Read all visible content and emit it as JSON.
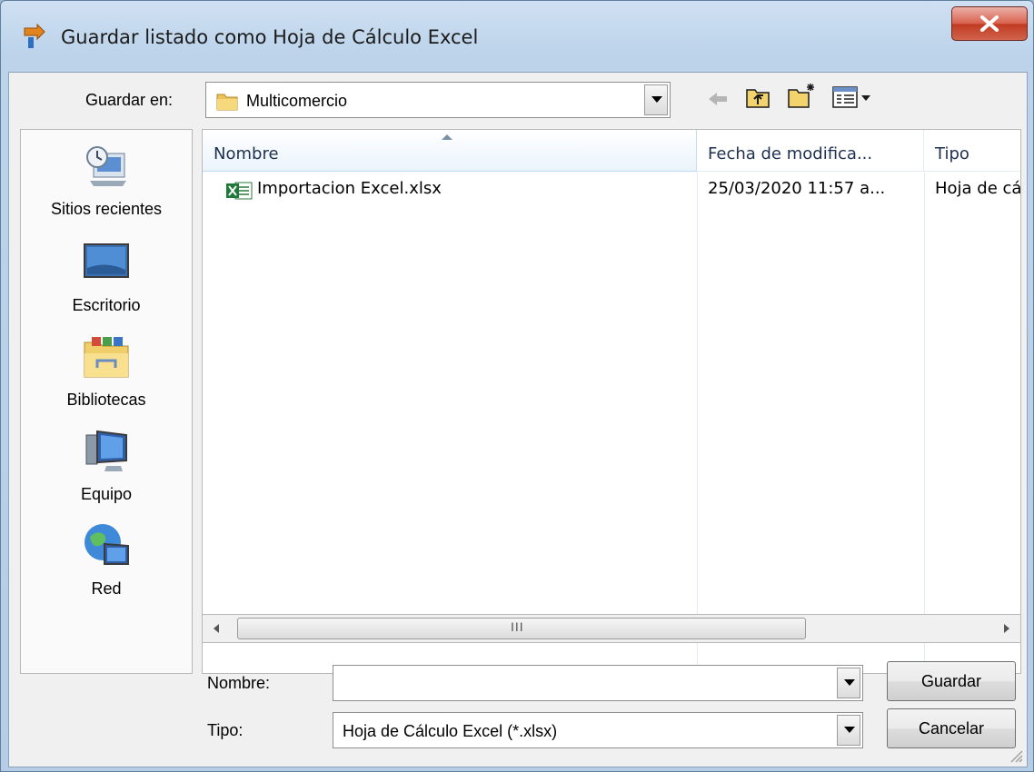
{
  "window": {
    "title": "Guardar listado como Hoja de Cálculo Excel",
    "close_glyph": "X"
  },
  "toolbar": {
    "save_in_label": "Guardar en:",
    "save_in_value": "Multicomercio",
    "icons": [
      "back-arrow-icon",
      "up-folder-icon",
      "new-folder-icon",
      "view-menu-icon"
    ]
  },
  "places": [
    {
      "label": "Sitios recientes",
      "icon": "recent-places-icon"
    },
    {
      "label": "Escritorio",
      "icon": "desktop-icon"
    },
    {
      "label": "Bibliotecas",
      "icon": "libraries-icon"
    },
    {
      "label": "Equipo",
      "icon": "computer-icon"
    },
    {
      "label": "Red",
      "icon": "network-icon"
    }
  ],
  "list": {
    "columns": [
      "Nombre",
      "Fecha de modifica...",
      "Tipo"
    ],
    "rows": [
      {
        "name": "Importacion Excel.xlsx",
        "date": "25/03/2020 11:57 a...",
        "type": "Hoja de cá",
        "icon": "excel-file-icon"
      }
    ],
    "scroll_grip": "III"
  },
  "form": {
    "name_label": "Nombre:",
    "name_value": "",
    "type_label": "Tipo:",
    "type_value": "Hoja de Cálculo Excel (*.xlsx)",
    "save_button": "Guardar",
    "cancel_button": "Cancelar"
  }
}
